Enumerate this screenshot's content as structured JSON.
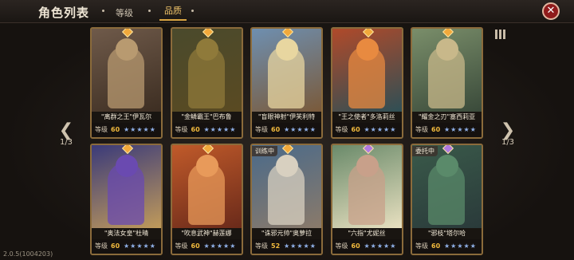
{
  "header": {
    "title": "角色列表",
    "tabs": [
      {
        "label": "等级",
        "active": false
      },
      {
        "label": "品质",
        "active": true
      }
    ],
    "close_icon": "close-icon"
  },
  "nav": {
    "left_page": "1/3",
    "right_page": "1/3"
  },
  "version": "2.0.5(1004203)",
  "colors": {
    "accent": "#f2c56a",
    "level": "#f0b93d",
    "close": "#8f1b1b"
  },
  "cards": [
    {
      "name": "\"离群之王\"伊瓦尔",
      "level_label": "等级",
      "level": "60",
      "stars": "★★★★★",
      "status": "",
      "gem": "#f2a93b",
      "art": [
        "#6f5a4a",
        "#b89a70",
        "#3d2e22"
      ]
    },
    {
      "name": "\"金鳞霸王\"巴布鲁",
      "level_label": "等级",
      "level": "60",
      "stars": "★★★★★",
      "status": "",
      "gem": "#f2a93b",
      "art": [
        "#4a4a2c",
        "#8f7a3a",
        "#5a4a22"
      ]
    },
    {
      "name": "\"盲眼神射\"伊芙利特",
      "level_label": "等级",
      "level": "60",
      "stars": "★★★★★",
      "status": "",
      "gem": "#f2a93b",
      "art": [
        "#6e8fb0",
        "#e8d6a0",
        "#7a5a3a"
      ]
    },
    {
      "name": "\"王之使者\"多洛莉丝",
      "level_label": "等级",
      "level": "60",
      "stars": "★★★★★",
      "status": "",
      "gem": "#f2a93b",
      "art": [
        "#b04a2a",
        "#e88a40",
        "#2f4f55"
      ]
    },
    {
      "name": "\"耀金之刃\"塞西莉亚",
      "level_label": "等级",
      "level": "60",
      "stars": "★★★★★",
      "status": "",
      "gem": "#f2a93b",
      "art": [
        "#7a8e6a",
        "#c8b88a",
        "#3a4a3a"
      ]
    },
    {
      "name": "\"奥法女皇\"杜晴",
      "level_label": "等级",
      "level": "60",
      "stars": "★★★★★",
      "status": "",
      "gem": "#f2a93b",
      "art": [
        "#3a3a7a",
        "#6a4ab0",
        "#c09a5a"
      ]
    },
    {
      "name": "\"吹息武神\"赫莲娜",
      "level_label": "等级",
      "level": "60",
      "stars": "★★★★★",
      "status": "",
      "gem": "#f2a93b",
      "art": [
        "#c05a2a",
        "#e89a5a",
        "#6a2a1a"
      ]
    },
    {
      "name": "\"诛邪元帅\"奥萝拉",
      "level_label": "等级",
      "level": "52",
      "stars": "★★★★★",
      "status": "训练中",
      "gem": "#f2a93b",
      "art": [
        "#4a6a8a",
        "#d8d0c0",
        "#8a7a6a"
      ]
    },
    {
      "name": "\"六指\"尤妮丝",
      "level_label": "等级",
      "level": "60",
      "stars": "★★★★★",
      "status": "",
      "gem": "#b07ae0",
      "art": [
        "#6a8a6a",
        "#c8a08a",
        "#e8e0c0"
      ]
    },
    {
      "name": "\"邪枝\"塔尔哈",
      "level_label": "等级",
      "level": "60",
      "stars": "★★★★★",
      "status": "委托中",
      "gem": "#b07ae0",
      "art": [
        "#3a5a4a",
        "#5a8a6a",
        "#2a3a3a"
      ]
    }
  ]
}
